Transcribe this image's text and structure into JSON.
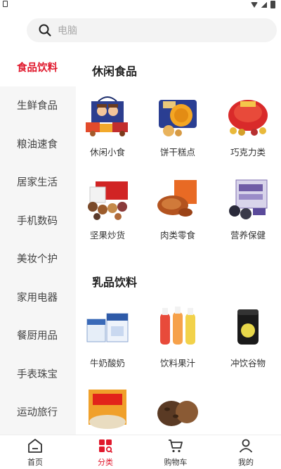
{
  "search": {
    "placeholder": "电脑"
  },
  "sidebar": {
    "items": [
      {
        "label": "食品饮料",
        "active": true
      },
      {
        "label": "生鲜食品"
      },
      {
        "label": "粮油速食"
      },
      {
        "label": "居家生活"
      },
      {
        "label": "手机数码"
      },
      {
        "label": "美妆个护"
      },
      {
        "label": "家用电器"
      },
      {
        "label": "餐厨用品"
      },
      {
        "label": "手表珠宝"
      },
      {
        "label": "运动旅行"
      }
    ]
  },
  "sections": [
    {
      "title": "休闲食品",
      "items": [
        {
          "label": "休闲小食",
          "icon": "snack-gift-box"
        },
        {
          "label": "饼干糕点",
          "icon": "biscuit-tin"
        },
        {
          "label": "巧克力类",
          "icon": "chocolate-box"
        },
        {
          "label": "坚果炒货",
          "icon": "nuts-gift-box"
        },
        {
          "label": "肉类零食",
          "icon": "roast-duck"
        },
        {
          "label": "营养保健",
          "icon": "ejiao-sesame-balls"
        }
      ]
    },
    {
      "title": "乳品饮料",
      "items": [
        {
          "label": "牛奶酸奶",
          "icon": "milk-cartons"
        },
        {
          "label": "饮料果汁",
          "icon": "juice-bottles"
        },
        {
          "label": "冲饮谷物",
          "icon": "cereal-jar"
        },
        {
          "label": "",
          "icon": "oatmeal-pack"
        },
        {
          "label": "",
          "icon": "coffee-beans"
        }
      ]
    }
  ],
  "tabbar": {
    "tabs": [
      {
        "label": "首页",
        "icon": "home-icon"
      },
      {
        "label": "分类",
        "icon": "category-icon",
        "active": true
      },
      {
        "label": "购物车",
        "icon": "cart-icon"
      },
      {
        "label": "我的",
        "icon": "profile-icon"
      }
    ]
  },
  "colors": {
    "accent": "#e0182c",
    "sidebar_bg": "#f6f6f6",
    "search_bg": "#f3f3f3"
  }
}
